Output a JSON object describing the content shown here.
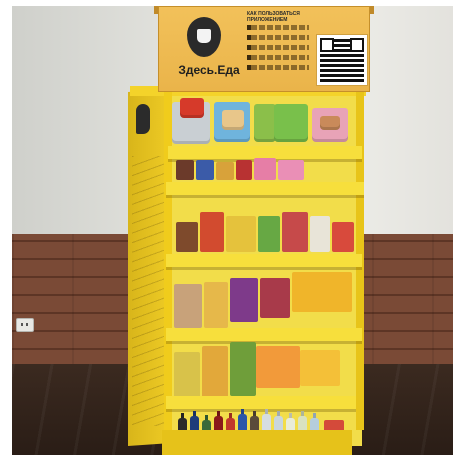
{
  "sign": {
    "brand": "Здесь.Еда",
    "heading": "КАК ПОЛЬЗОВАТЬСЯ ПРИЛОЖЕНИЕМ"
  },
  "colors": {
    "rack": "#f2d22a",
    "sign": "#eeb84f",
    "wall": "#e6e6e1",
    "wainscot": "#7a4a36",
    "floor": "#2f211a"
  },
  "icons": {
    "sign_logo": "food-cup-icon",
    "side_logo": "food-cup-icon",
    "qr": "qr-code-icon"
  }
}
